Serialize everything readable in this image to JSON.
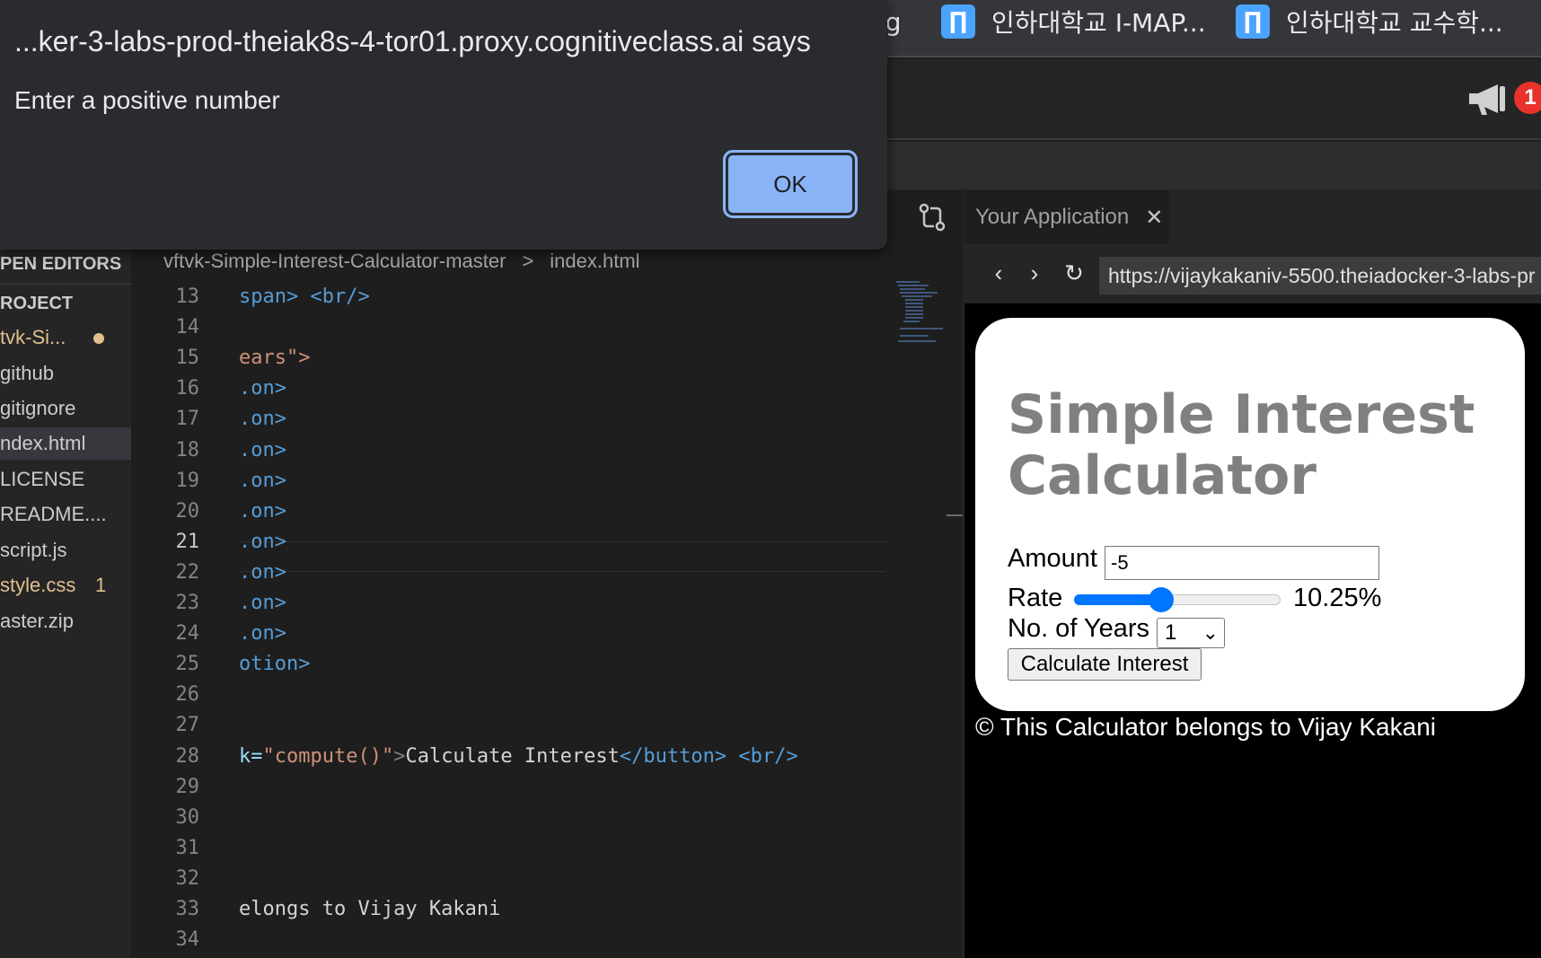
{
  "bookmarks": [
    {
      "label": "ng"
    },
    {
      "label": "인하대학교 I-MAP..."
    },
    {
      "label": "인하대학교 교수학..."
    }
  ],
  "topbar": {
    "notification_count": "1"
  },
  "dialog": {
    "title": "...ker-3-labs-prod-theiak8s-4-tor01.proxy.cognitiveclass.ai says",
    "message": "Enter a positive number",
    "ok_label": "OK"
  },
  "explorer": {
    "header_open_editors": "PEN EDITORS",
    "header_project": "ROJECT",
    "items": [
      {
        "label": "tvk-Si..."
      },
      {
        "label": "github"
      },
      {
        "label": "gitignore"
      },
      {
        "label": "ndex.html"
      },
      {
        "label": "LICENSE"
      },
      {
        "label": "README...."
      },
      {
        "label": "script.js"
      },
      {
        "label": "style.css"
      },
      {
        "label": "aster.zip"
      }
    ],
    "style_css_problems": "1"
  },
  "breadcrumb": {
    "folder": "vftvk-Simple-Interest-Calculator-master",
    "separator": ">",
    "file": "index.html"
  },
  "editor": {
    "current_line": "21",
    "lines": [
      {
        "n": "13",
        "a": "span>",
        "b": " <br/>"
      },
      {
        "n": "14",
        "a": "",
        "b": ""
      },
      {
        "n": "15",
        "a": "ears\">",
        "b": ""
      },
      {
        "n": "16",
        "a": ".on>",
        "b": ""
      },
      {
        "n": "17",
        "a": ".on>",
        "b": ""
      },
      {
        "n": "18",
        "a": ".on>",
        "b": ""
      },
      {
        "n": "19",
        "a": ".on>",
        "b": ""
      },
      {
        "n": "20",
        "a": ".on>",
        "b": ""
      },
      {
        "n": "21",
        "a": ".on>",
        "b": ""
      },
      {
        "n": "22",
        "a": ".on>",
        "b": ""
      },
      {
        "n": "23",
        "a": ".on>",
        "b": ""
      },
      {
        "n": "24",
        "a": ".on>",
        "b": ""
      },
      {
        "n": "25",
        "a": "otion>",
        "b": ""
      },
      {
        "n": "26",
        "a": "",
        "b": ""
      },
      {
        "n": "27",
        "a": "",
        "b": ""
      },
      {
        "n": "28",
        "a": "k=\"compute()\">Calculate Interest</button>",
        "b": " <br/>"
      },
      {
        "n": "29",
        "a": "",
        "b": ""
      },
      {
        "n": "30",
        "a": "",
        "b": ""
      },
      {
        "n": "31",
        "a": "",
        "b": ""
      },
      {
        "n": "32",
        "a": "",
        "b": ""
      },
      {
        "n": "33",
        "a": "elongs to Vijay Kakani",
        "b": ""
      },
      {
        "n": "34",
        "a": "",
        "b": ""
      }
    ]
  },
  "preview": {
    "tab_label": "Your Application",
    "url": "https://vijaykakaniv-5500.theiadocker-3-labs-pr",
    "app": {
      "title": "Simple Interest Calculator",
      "amount_label": "Amount",
      "amount_value": "-5",
      "rate_label": "Rate",
      "rate_value": "10.25%",
      "rate_fraction": 0.41,
      "years_label": "No. of Years",
      "years_value": "1",
      "button_label": "Calculate Interest",
      "footer": "© This Calculator belongs to Vijay Kakani"
    }
  },
  "colors": {
    "accent_blue": "#8ab4f8",
    "slider_blue": "#0075ff",
    "badge_red": "#e8322c",
    "modified_yellow": "#e2c08d"
  }
}
